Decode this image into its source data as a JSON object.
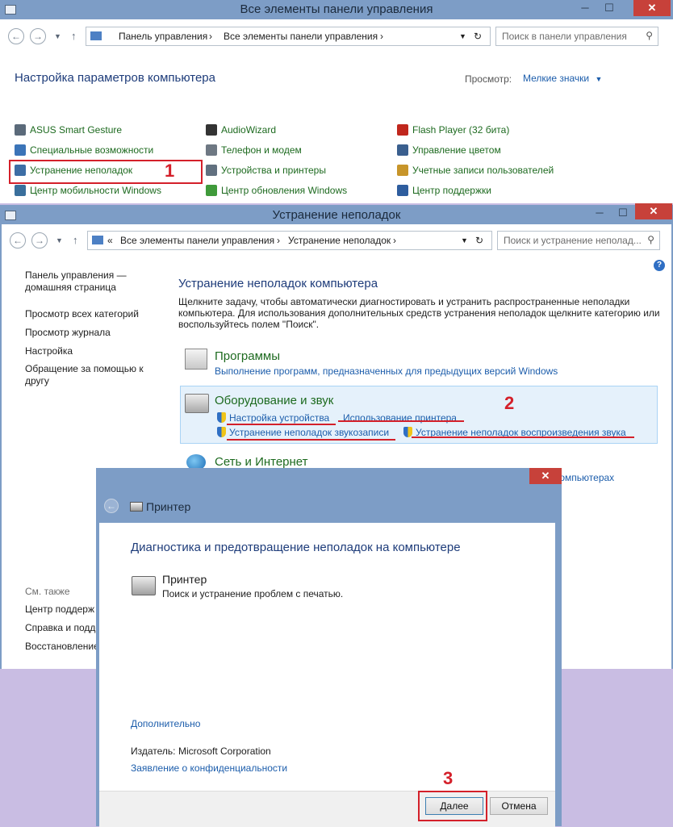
{
  "win1": {
    "title": "Все элементы панели управления",
    "addr": [
      "Панель управления",
      "Все элементы панели управления"
    ],
    "search_placeholder": "Поиск в панели управления",
    "heading": "Настройка параметров компьютера",
    "view_label": "Просмотр:",
    "view_value": "Мелкие значки",
    "items": [
      {
        "label": "ASUS Smart Gesture",
        "icon": "touchpad-icon",
        "color": "#5b6a7a"
      },
      {
        "label": "Специальные возможности",
        "icon": "accessibility-icon",
        "color": "#3b74b8"
      },
      {
        "label": "Устранение неполадок",
        "icon": "troubleshoot-icon",
        "color": "#3d6ea5"
      },
      {
        "label": "Центр мобильности Windows",
        "icon": "mobility-icon",
        "color": "#3a6f9c"
      },
      {
        "label": "AudioWizard",
        "icon": "audio-icon",
        "color": "#333333"
      },
      {
        "label": "Телефон и модем",
        "icon": "modem-icon",
        "color": "#6e7883"
      },
      {
        "label": "Устройства и принтеры",
        "icon": "printer-icon",
        "color": "#61707f"
      },
      {
        "label": "Центр обновления Windows",
        "icon": "update-icon",
        "color": "#3f9a3a"
      },
      {
        "label": "Flash Player (32 бита)",
        "icon": "flash-icon",
        "color": "#c0271d"
      },
      {
        "label": "Управление цветом",
        "icon": "color-monitor-icon",
        "color": "#3a5f8e"
      },
      {
        "label": "Учетные записи пользователей",
        "icon": "users-icon",
        "color": "#c7952a"
      },
      {
        "label": "Центр поддержки",
        "icon": "flag-icon",
        "color": "#2e5d9e"
      }
    ]
  },
  "win2": {
    "title": "Устранение неполадок",
    "addr": [
      "«",
      "Все элементы панели управления",
      "Устранение неполадок"
    ],
    "search_placeholder": "Поиск и устранение неполад...",
    "left_links": [
      "Панель управления —",
      "домашняя страница",
      "Просмотр всех категорий",
      "Просмотр журнала",
      "Настройка",
      "Обращение за помощью к",
      "другу"
    ],
    "see_also": "См. также",
    "see_also_links": [
      "Центр поддерж",
      "Справка и подде",
      "Восстановление"
    ],
    "heading": "Устранение неполадок компьютера",
    "desc": [
      "Щелкните задачу, чтобы автоматически диагностировать и устранить распространенные неполадки",
      "компьютера. Для использования дополнительных средств устранения неполадок щелкните категорию или",
      "воспользуйтесь полем \"Поиск\"."
    ],
    "cat1_title": "Программы",
    "cat1_link": "Выполнение программ, предназначенных для предыдущих версий Windows",
    "cat2_title": "Оборудование и звук",
    "cat2_links": [
      "Настройка устройства",
      "Использование принтера",
      "Устранение неполадок звукозаписи",
      "Устранение неполадок воспроизведения звука"
    ],
    "cat3_title": "Сеть и Интернет",
    "cat3_partial": "компьютерах"
  },
  "dialog": {
    "title": "Принтер",
    "heading": "Диагностика и предотвращение неполадок на компьютере",
    "item_title": "Принтер",
    "item_desc": "Поиск и устранение проблем с печатью.",
    "more": "Дополнительно",
    "publisher_label": "Издатель:",
    "publisher": "Microsoft Corporation",
    "privacy": "Заявление о конфиденциальности",
    "next": "Далее",
    "cancel": "Отмена"
  },
  "annotations": [
    "1",
    "2",
    "3"
  ],
  "colors": {
    "titlebar": "#7d9dc6",
    "close": "#c7413a",
    "annotation": "#d4202a",
    "link": "#1c5dab",
    "green_link": "#1d6a1f"
  }
}
